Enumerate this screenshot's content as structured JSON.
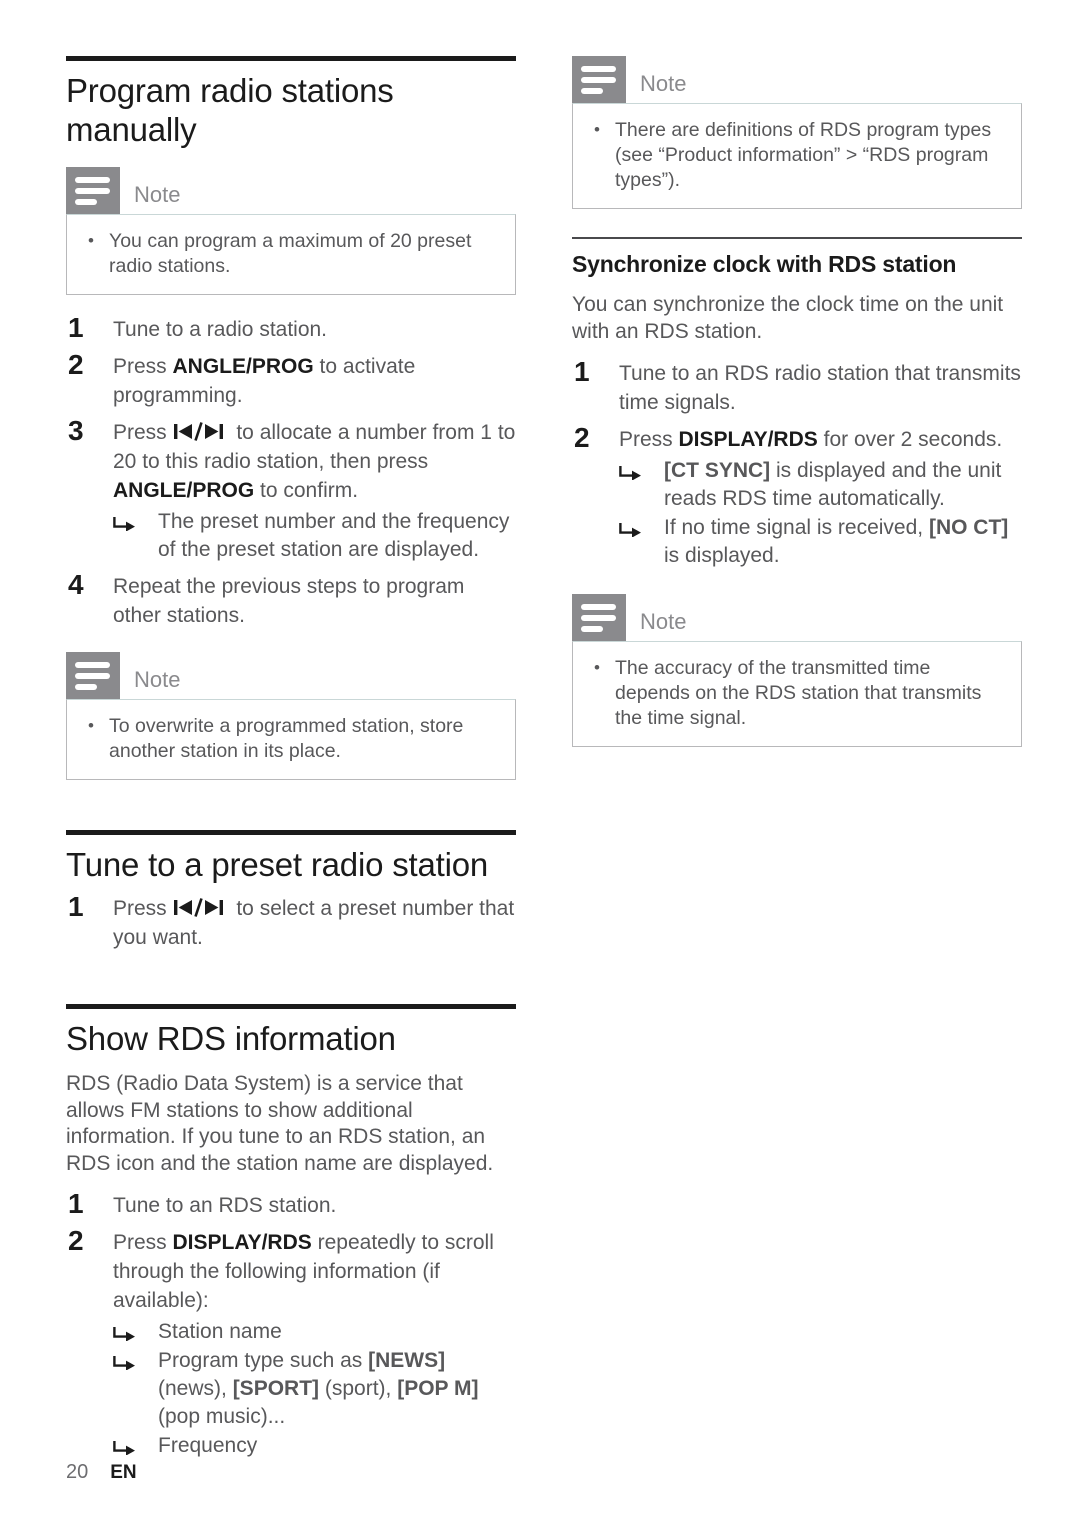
{
  "document": {
    "page_number": "20",
    "language_code": "EN"
  },
  "icons": {
    "note": "note-icon",
    "arrow_result": "arrow-result-icon",
    "prev_next": "prev-next-track-icon"
  },
  "colors": {
    "heading": "#1b1b1b",
    "body_text": "#58585a",
    "note_gray": "#8a8a8d",
    "note_border": "#b8b8ba",
    "rule_thick": "#1b1b1b",
    "rule_thin": "#4a4a4c"
  },
  "left_column": {
    "section1": {
      "title": "Program radio stations manually",
      "note": {
        "label": "Note",
        "items": [
          "You can program a maximum of 20 preset radio stations."
        ]
      },
      "steps": [
        {
          "num": "1",
          "parts": [
            {
              "t": "Tune to a radio station."
            }
          ],
          "results": []
        },
        {
          "num": "2",
          "parts": [
            {
              "t": "Press "
            },
            {
              "t": "ANGLE/PROG",
              "bold": true
            },
            {
              "t": " to activate programming."
            }
          ],
          "results": []
        },
        {
          "num": "3",
          "parts": [
            {
              "t": "Press "
            },
            {
              "icon": "prev-next-track-icon"
            },
            {
              "t": " to allocate a number from 1 to 20 to this radio station, then press "
            },
            {
              "t": "ANGLE/PROG",
              "bold": true
            },
            {
              "t": " to confirm."
            }
          ],
          "results": [
            "The preset number and the frequency of the preset station are displayed."
          ]
        },
        {
          "num": "4",
          "parts": [
            {
              "t": "Repeat the previous steps to program other stations."
            }
          ],
          "results": []
        }
      ],
      "note2": {
        "label": "Note",
        "items": [
          "To overwrite a programmed station, store another station in its place."
        ]
      }
    },
    "section2": {
      "title": "Tune to a preset radio station",
      "steps": [
        {
          "num": "1",
          "parts": [
            {
              "t": "Press "
            },
            {
              "icon": "prev-next-track-icon"
            },
            {
              "t": " to select a preset number that you want."
            }
          ],
          "results": []
        }
      ]
    },
    "section3": {
      "title": "Show RDS information",
      "intro": "RDS (Radio Data System) is a service that allows FM stations to show additional information. If you tune to an RDS station, an RDS icon and the station name are displayed.",
      "steps": [
        {
          "num": "1",
          "parts": [
            {
              "t": "Tune to an RDS station."
            }
          ],
          "results": []
        },
        {
          "num": "2",
          "parts": [
            {
              "t": "Press "
            },
            {
              "t": "DISPLAY/RDS",
              "bold": true
            },
            {
              "t": " repeatedly to scroll through the following information (if available):"
            }
          ],
          "results_rich": [
            [
              {
                "t": "Station name"
              }
            ],
            [
              {
                "t": "Program type such as "
              },
              {
                "t": "[NEWS]",
                "bold": true
              },
              {
                "t": " (news), "
              },
              {
                "t": "[SPORT]",
                "bold": true
              },
              {
                "t": " (sport), "
              },
              {
                "t": "[POP M]",
                "bold": true
              },
              {
                "t": " (pop music)..."
              }
            ],
            [
              {
                "t": "Frequency"
              }
            ]
          ]
        }
      ]
    }
  },
  "right_column": {
    "note_top": {
      "label": "Note",
      "items": [
        "There are definitions of RDS program types (see “Product information” > “RDS program types”)."
      ]
    },
    "section1": {
      "title": "Synchronize clock with RDS station",
      "intro": "You can synchronize the clock time on the unit with an RDS station.",
      "steps": [
        {
          "num": "1",
          "parts": [
            {
              "t": "Tune to an RDS radio station that transmits time signals."
            }
          ],
          "results_rich": []
        },
        {
          "num": "2",
          "parts": [
            {
              "t": "Press "
            },
            {
              "t": "DISPLAY/RDS",
              "bold": true
            },
            {
              "t": " for over 2 seconds."
            }
          ],
          "results_rich": [
            [
              {
                "t": "[CT SYNC]",
                "bold": true
              },
              {
                "t": " is displayed and the unit reads RDS time automatically."
              }
            ],
            [
              {
                "t": "If no time signal is received, "
              },
              {
                "t": "[NO CT]",
                "bold": true
              },
              {
                "t": " is displayed."
              }
            ]
          ]
        }
      ],
      "note": {
        "label": "Note",
        "items": [
          "The accuracy of the transmitted time depends on the RDS station that transmits the time signal."
        ]
      }
    }
  }
}
